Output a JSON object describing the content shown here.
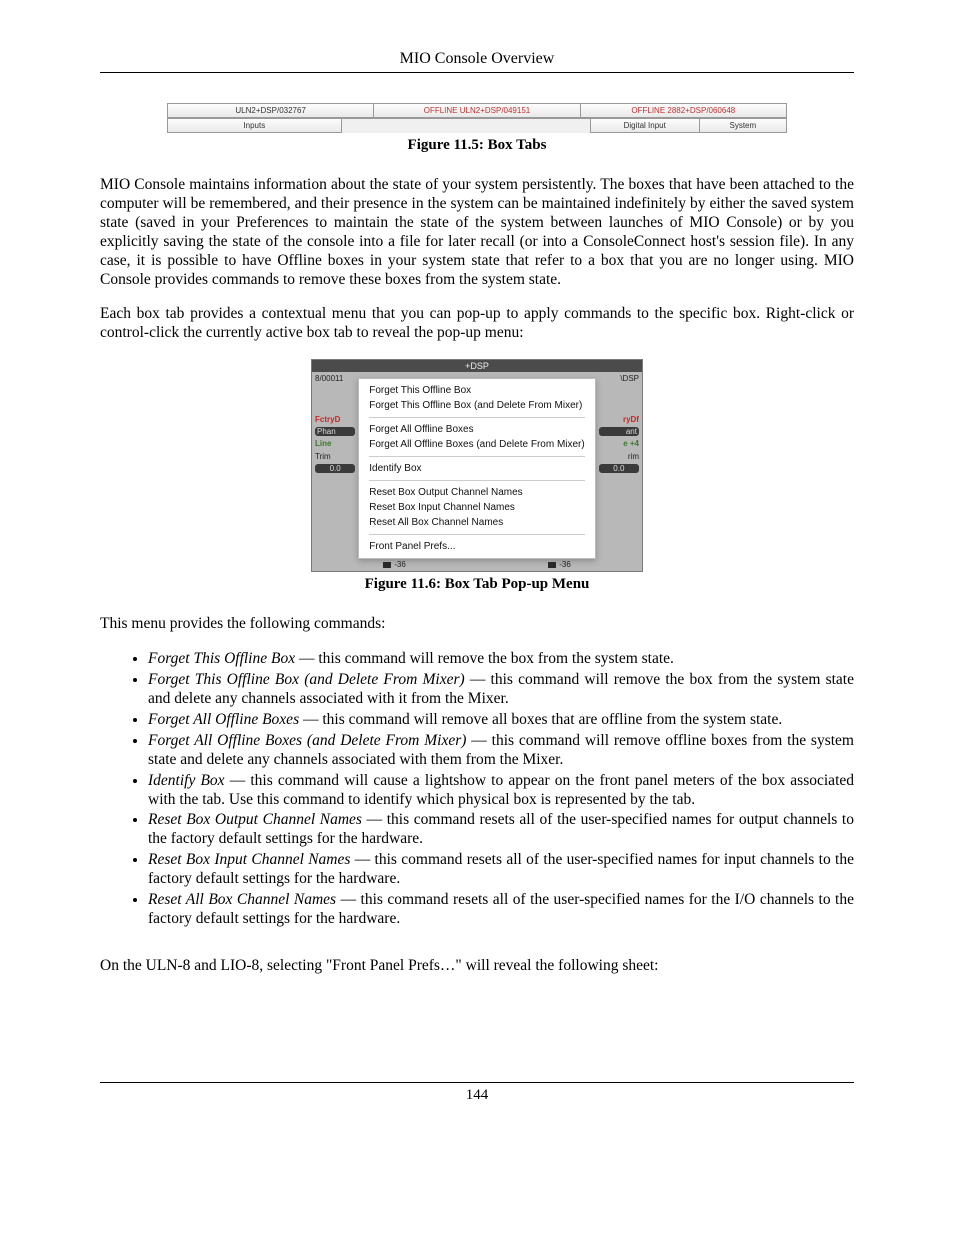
{
  "header": {
    "title": "MIO Console Overview"
  },
  "footer": {
    "page_number": "144"
  },
  "fig_11_5": {
    "caption": "Figure 11.5: Box Tabs",
    "row1": [
      {
        "label": "ULN2+DSP/032767",
        "offline": false
      },
      {
        "label": "OFFLINE ULN2+DSP/049151",
        "offline": true
      },
      {
        "label": "OFFLINE 2882+DSP/060648",
        "offline": true
      }
    ],
    "row2": [
      {
        "label": "Inputs"
      },
      {
        "label": "Digital Input"
      },
      {
        "label": "System"
      }
    ]
  },
  "para1": "MIO Console maintains information about the state of your system persistently. The boxes that have been attached to the computer will be remembered, and their presence in the system can be maintained indefinitely by either the saved system state (saved in your Preferences to maintain the state of the system between launches of MIO Console) or by you explicitly saving the state of the console into a file for later recall (or into a ConsoleConnect host's session file). In any case, it is possible to have Offline boxes in your system state that refer to a box that you are no longer using. MIO Console provides commands to remove these boxes from the system state.",
  "para2": "Each box tab provides a contextual menu that you can pop-up to apply commands to the specific box. Right-click or control-click the currently active box tab to reveal the pop-up menu:",
  "fig_11_6": {
    "caption": "Figure 11.6: Box Tab Pop-up Menu",
    "window_title": "+DSP",
    "left_stubs": {
      "id": "8/00011",
      "red": "FctryD",
      "dark": "Phan",
      "green": "Line",
      "trim": "Trim",
      "val": "0.0"
    },
    "right_stubs": {
      "dsp": "\\DSP",
      "red": "ryDf",
      "dark": "ant",
      "green": "e +4",
      "trim": "rim",
      "val": "0.0"
    },
    "menu_items_g1": [
      "Forget This Offline Box",
      "Forget This Offline Box (and Delete From Mixer)"
    ],
    "menu_items_g2": [
      "Forget All Offline Boxes",
      "Forget All Offline Boxes (and Delete From Mixer)"
    ],
    "menu_items_g3": [
      "Identify Box"
    ],
    "menu_items_g4": [
      "Reset Box Output Channel Names",
      "Reset Box Input Channel Names",
      "Reset All Box Channel Names"
    ],
    "menu_items_g5": [
      "Front Panel Prefs..."
    ],
    "bottom_left": "-36",
    "bottom_right": "-36"
  },
  "para3": "This menu provides the following commands:",
  "commands": [
    {
      "name": "Forget This Offline Box",
      "desc": " — this command will remove the box from the system state."
    },
    {
      "name": "Forget This Offline Box (and Delete From Mixer)",
      "desc": " — this command will remove the box from the system state and delete any channels associated with it from the Mixer."
    },
    {
      "name": "Forget All Offline Boxes",
      "desc": " — this command will remove all boxes that are offline from the system state."
    },
    {
      "name": "Forget All Offline Boxes (and Delete From Mixer)",
      "desc": " — this command will remove offline boxes from the system state and delete any channels associated with them from the Mixer."
    },
    {
      "name": "Identify Box",
      "desc": " — this command will cause a lightshow to appear on the front panel meters of the box associated with the tab. Use this command to identify which physical box is represented by the tab."
    },
    {
      "name": "Reset Box Output Channel Names",
      "desc": " — this command resets all of the user-specified names for output channels to the factory default settings for the hardware."
    },
    {
      "name": "Reset Box Input Channel Names",
      "desc": " — this command resets all of the user-specified names for input channels to the factory default settings for the hardware."
    },
    {
      "name": "Reset All Box Channel Names",
      "desc": " — this command resets all of the user-specified names for the I/O channels to the factory default settings for the hardware."
    }
  ],
  "para4": "On the ULN-8 and LIO-8, selecting \"Front Panel Prefs…\" will reveal the following sheet:"
}
